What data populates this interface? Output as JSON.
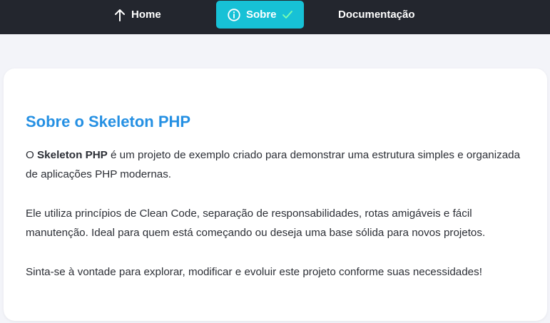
{
  "nav": {
    "home_label": "Home",
    "sobre_label": "Sobre",
    "docs_label": "Documentação",
    "active_color": "#17c1d6",
    "bar_color": "#23262e",
    "icons": {
      "home": "arrow-up-icon",
      "sobre": "info-circle-icon",
      "active": "check-icon"
    }
  },
  "content": {
    "title": "Sobre o Skeleton PHP",
    "title_color": "#2590e3",
    "p1_prefix": "O ",
    "p1_bold": "Skeleton PHP",
    "p1_rest": " é um projeto de exemplo criado para demonstrar uma estrutura simples e organizada de aplicações PHP modernas.",
    "p2": "Ele utiliza princípios de Clean Code, separação de responsabilidades, rotas amigáveis e fácil manutenção. Ideal para quem está começando ou deseja uma base sólida para novos projetos.",
    "p3": "Sinta-se à vontade para explorar, modificar e evoluir este projeto conforme suas necessidades!"
  }
}
